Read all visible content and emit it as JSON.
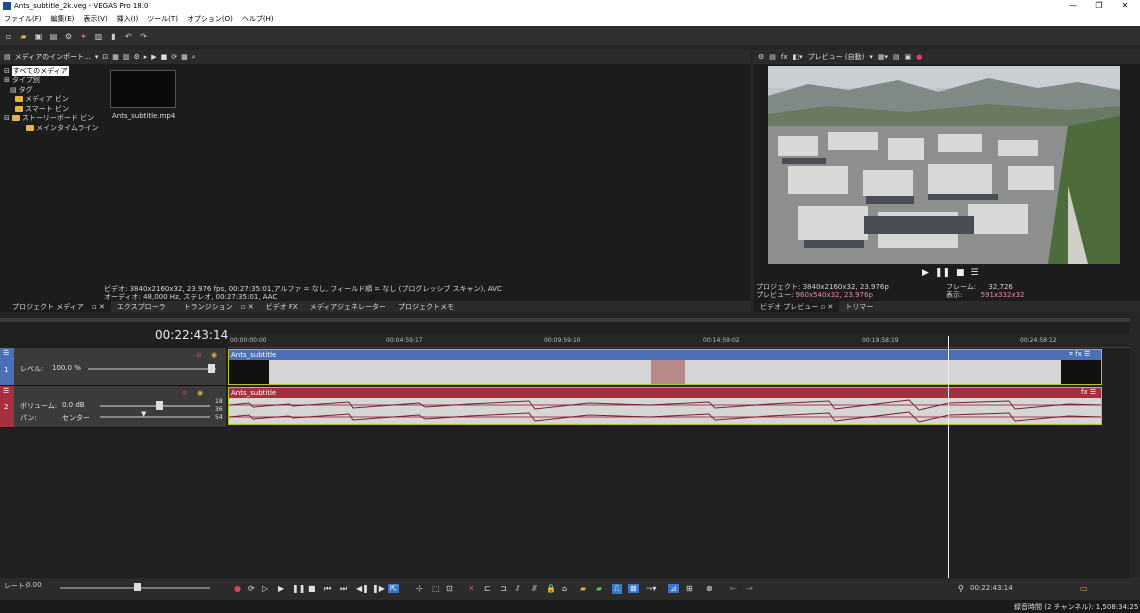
{
  "window": {
    "title": "Ants_subtitle_2k.veg - VEGAS Pro 18.0",
    "minimize": "—",
    "maximize": "❐",
    "close": "✕"
  },
  "menu": [
    "ファイル(F)",
    "編集(E)",
    "表示(V)",
    "挿入(I)",
    "ツール(T)",
    "オプション(O)",
    "ヘルプ(H)"
  ],
  "media": {
    "import_label": "メディアのインポート...",
    "tree": [
      "すべてのメディア",
      "タイプ別",
      "タグ",
      "メディア ビン",
      "スマート ビン",
      "ストーリーボード ビン",
      "メインタイムライン"
    ],
    "thumb_label": "Ants_subtitle.mp4",
    "info_line1": "ビデオ: 3840x2160x32, 23.976 fps, 00:27:35:01,アルファ = なし, フィールド順 = なし (プログレッシブ スキャン), AVC",
    "info_line2": "オーディオ: 48,000 Hz, ステレオ, 00:27:35:01, AAC"
  },
  "tabs": {
    "project_media": "プロジェクト メディア",
    "explorer": "エクスプローラ",
    "transitions": "トランジション",
    "video_fx": "ビデオ FX",
    "media_generators": "メディアジェネレーター",
    "project_notes": "プロジェクトメモ",
    "video_preview": "ビデオ プレビュー",
    "trimmer": "トリマー"
  },
  "preview": {
    "mode": "プレビュー (自動)",
    "project_label": "プロジェクト:",
    "project_value": "3840x2160x32, 23.976p",
    "preview_label": "プレビュー:",
    "preview_value": "960x540x32, 23.976p",
    "frame_label": "フレーム:",
    "frame_value": "32,726",
    "display_label": "表示:",
    "display_value": "591x332x32"
  },
  "timeline": {
    "time": "00:22:43:14",
    "ticks": [
      "00:00:00:00",
      "00:04:59:17",
      "00:09:59:10",
      "00:14:59:02",
      "00:19:58:19",
      "00:24:58:12"
    ],
    "video_track": {
      "number": "1",
      "level_label": "レベル:",
      "level_value": "100.0 %",
      "event_name": "Ants_subtitle"
    },
    "audio_track": {
      "number": "2",
      "volume_label": "ボリューム:",
      "volume_value": "0.0 dB",
      "pan_label": "パン:",
      "pan_value": "センター",
      "event_name": "Ants_subtitle",
      "meter": [
        "18",
        "36",
        "54"
      ]
    }
  },
  "transport": {
    "rate_label": "レート:",
    "rate_value": "0.00",
    "cursor_time": "00:22:43:14"
  },
  "status": {
    "record_time": "録音時間 (2 チャンネル): 1,508:34:25"
  },
  "colors": {
    "video_header": "#4c6fb5",
    "audio_header": "#a63040",
    "event_border": "#b8c21c"
  }
}
